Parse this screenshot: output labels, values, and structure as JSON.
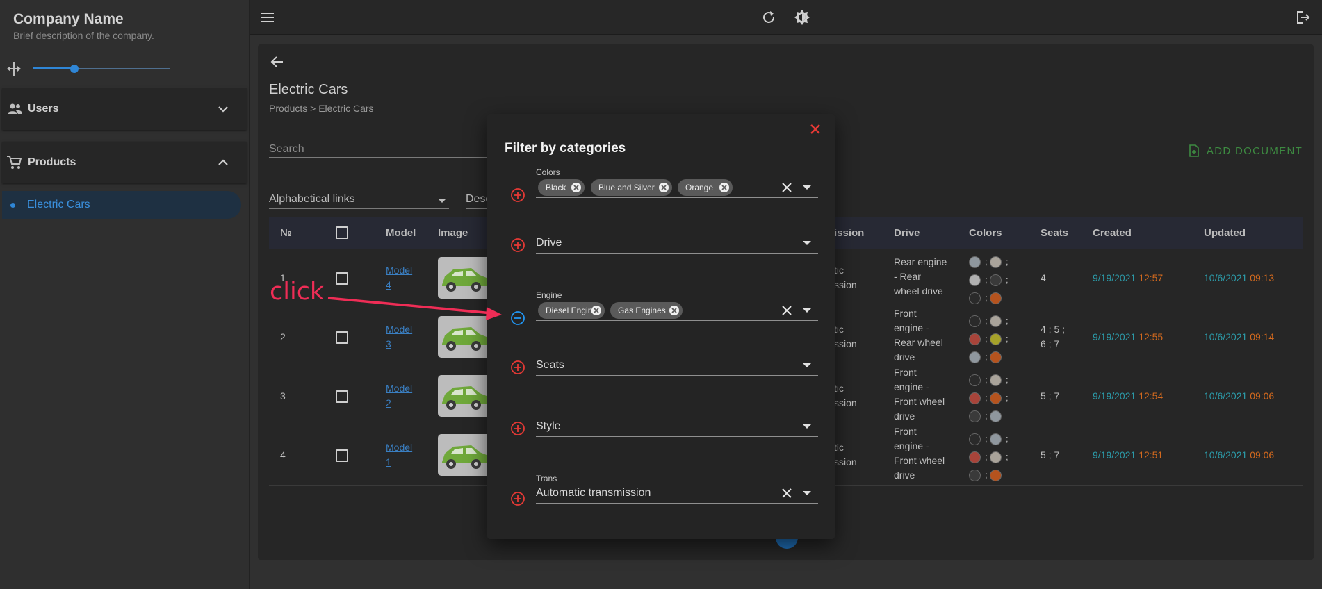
{
  "sidebar": {
    "company_name": "Company Name",
    "company_desc": "Brief description of the company.",
    "width_slider_value": 0.3,
    "groups": [
      {
        "label": "Users",
        "icon": "users-icon",
        "expanded": false
      },
      {
        "label": "Products",
        "icon": "cart-icon",
        "expanded": true
      }
    ],
    "active_item": "Electric Cars"
  },
  "topbar": {
    "icons": [
      "menu-icon",
      "refresh-icon",
      "theme-icon",
      "logout-icon"
    ]
  },
  "page": {
    "title": "Electric Cars",
    "breadcrumb": "Products > Electric Cars",
    "search_placeholder": "Search",
    "alpha_select": "Alphabetical links",
    "desc_select": "Desc",
    "add_document": "ADD DOCUMENT"
  },
  "table": {
    "headers": {
      "num": "№",
      "model": "Model",
      "image": "Image",
      "trans": "ission",
      "drive": "Drive",
      "colors": "Colors",
      "seats": "Seats",
      "created": "Created",
      "updated": "Updated"
    },
    "rows": [
      {
        "num": "1",
        "model": [
          "Model",
          "4"
        ],
        "trans": [
          "tic",
          "ssion"
        ],
        "drive": [
          "Rear engine",
          "- Rear",
          "wheel drive"
        ],
        "seats": [
          "4"
        ],
        "created_date": "9/19/2021",
        "created_time": "12:57",
        "updated_date": "10/6/2021",
        "updated_time": "09:13",
        "colors": [
          "#8f979e",
          "#a9a39a",
          "#b1b1b1",
          "#3a3a3a",
          "#2a2a2a",
          "#b5531e"
        ]
      },
      {
        "num": "2",
        "model": [
          "Model",
          "3"
        ],
        "trans": [
          "tic",
          "ssion"
        ],
        "drive": [
          "Front",
          "engine -",
          "Rear wheel",
          "drive"
        ],
        "seats": [
          "4 ; 5 ;",
          "6 ; 7"
        ],
        "created_date": "9/19/2021",
        "created_time": "12:55",
        "updated_date": "10/6/2021",
        "updated_time": "09:14",
        "colors": [
          "#2a2a2a",
          "#a9a39a",
          "#a8443a",
          "#a6a22a",
          "#8f979e",
          "#b5531e"
        ]
      },
      {
        "num": "3",
        "model": [
          "Model",
          "2"
        ],
        "trans": [
          "tic",
          "ssion"
        ],
        "drive": [
          "Front",
          "engine -",
          "Front wheel",
          "drive"
        ],
        "seats": [
          "5 ; 7"
        ],
        "created_date": "9/19/2021",
        "created_time": "12:54",
        "updated_date": "10/6/2021",
        "updated_time": "09:06",
        "colors": [
          "#2a2a2a",
          "#a9a39a",
          "#a8443a",
          "#b5531e",
          "#3a3a3a",
          "#8f979e"
        ]
      },
      {
        "num": "4",
        "model": [
          "Model",
          "1"
        ],
        "trans": [
          "tic",
          "ssion"
        ],
        "drive": [
          "Front",
          "engine -",
          "Front wheel",
          "drive"
        ],
        "seats": [
          "5 ; 7"
        ],
        "created_date": "9/19/2021",
        "created_time": "12:51",
        "updated_date": "10/6/2021",
        "updated_time": "09:06",
        "colors": [
          "#2a2a2a",
          "#8f979e",
          "#a8443a",
          "#a9a39a",
          "#3a3a3a",
          "#b5531e"
        ]
      }
    ]
  },
  "dialog": {
    "title": "Filter by categories",
    "filters": [
      {
        "label": "Colors",
        "chips": [
          "Black",
          "Blue and Silver",
          "Orange"
        ],
        "state": "add"
      },
      {
        "placeholder": "Drive",
        "state": "add"
      },
      {
        "label": "Engine",
        "chips": [
          "Diesel Engines",
          "Gas Engines"
        ],
        "state": "remove"
      },
      {
        "placeholder": "Seats",
        "state": "add"
      },
      {
        "placeholder": "Style",
        "state": "add"
      },
      {
        "label": "Trans",
        "value": "Automatic transmission",
        "state": "add"
      }
    ]
  },
  "annotation": {
    "text": "click",
    "color": "#ef2d56"
  },
  "colors": {
    "accent": "#2f86d6",
    "add_red": "#e53935",
    "remove_blue": "#2196f3",
    "green": "#3d8a41"
  }
}
